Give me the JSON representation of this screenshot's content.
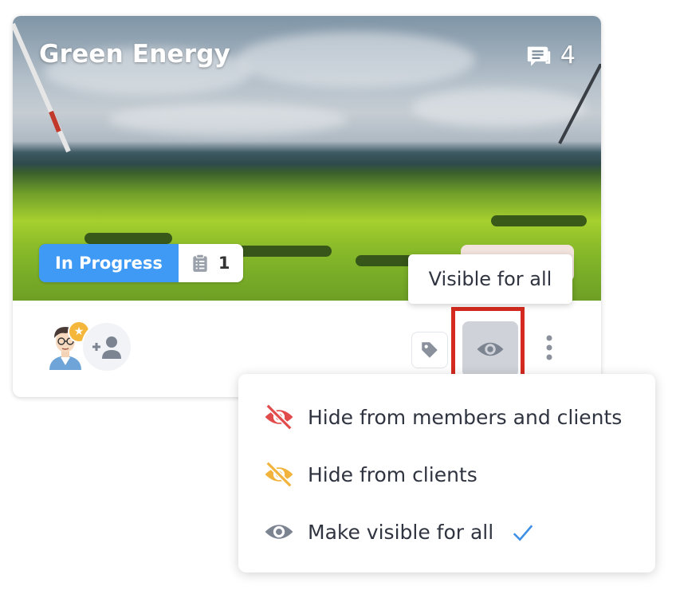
{
  "card": {
    "title": "Green Energy",
    "comment_count": "4",
    "status": "In Progress",
    "task_count": "1"
  },
  "tooltip": {
    "text": "Visible for all"
  },
  "visibility_menu": {
    "items": [
      {
        "label": "Hide from members and clients",
        "icon": "eye-off-icon",
        "color": "#e24b4b"
      },
      {
        "label": "Hide from clients",
        "icon": "eye-off-icon",
        "color": "#f2b33d"
      },
      {
        "label": "Make visible for all",
        "icon": "eye-icon",
        "color": "#7d8491",
        "selected": true
      }
    ]
  },
  "colors": {
    "status_badge": "#3f9af6",
    "highlight_box": "#d42a1f",
    "check": "#3b8fe5"
  }
}
